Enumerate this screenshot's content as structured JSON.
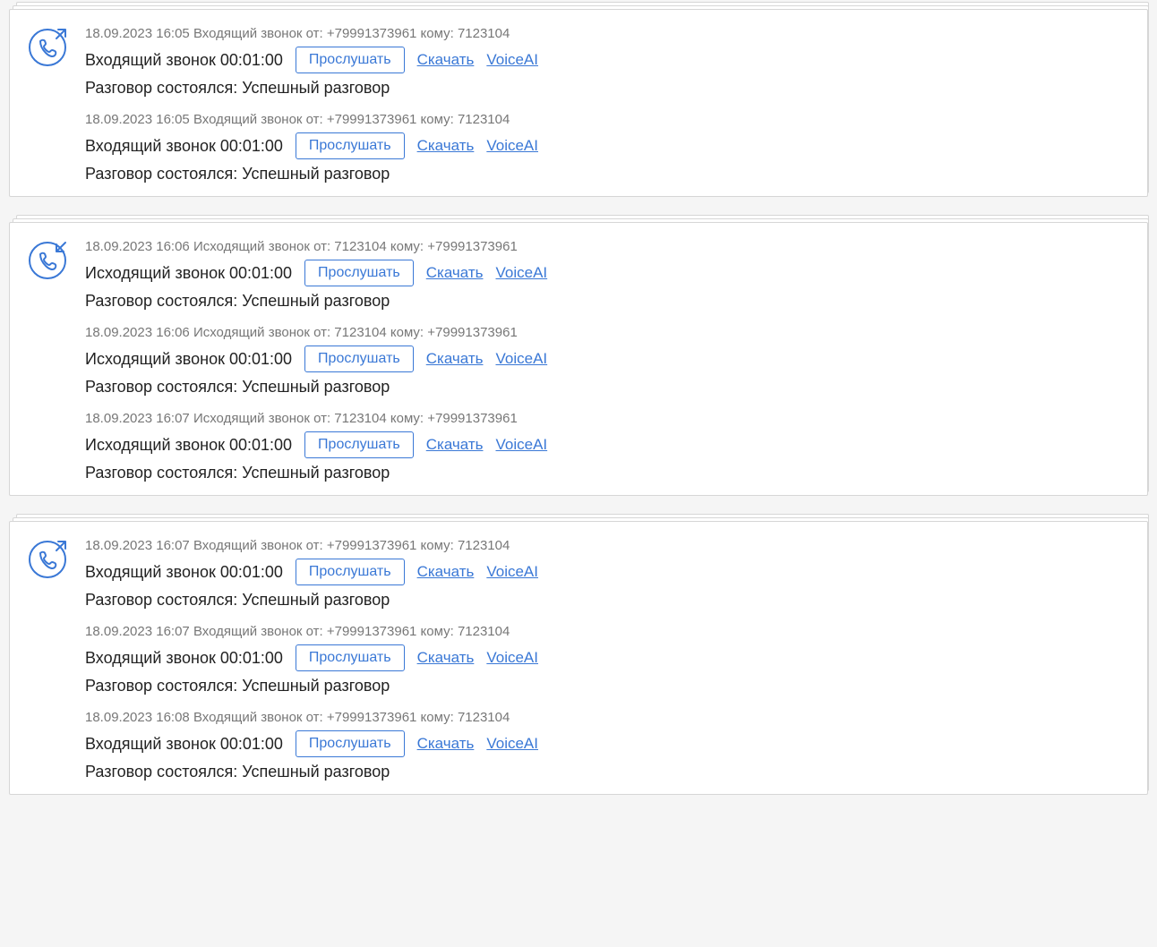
{
  "labels": {
    "play": "Прослушать",
    "download": "Скачать",
    "voiceai": "VoiceAI",
    "result_prefix": "Разговор состоялся: ",
    "from": "от:",
    "to": "кому:"
  },
  "groups": [
    {
      "direction": "incoming",
      "entries": [
        {
          "timestamp": "18.09.2023 16:05",
          "type_label": "Входящий звонок",
          "from": "+79991373961",
          "to": "7123104",
          "title": "Входящий звонок 00:01:00",
          "result": "Успешный разговор",
          "highlight_voiceai": true
        },
        {
          "timestamp": "18.09.2023 16:05",
          "type_label": "Входящий звонок",
          "from": "+79991373961",
          "to": "7123104",
          "title": "Входящий звонок 00:01:00",
          "result": "Успешный разговор",
          "highlight_voiceai": true
        }
      ]
    },
    {
      "direction": "outgoing",
      "entries": [
        {
          "timestamp": "18.09.2023 16:06",
          "type_label": "Исходящий звонок",
          "from": "7123104",
          "to": "+79991373961",
          "title": "Исходящий звонок 00:01:00",
          "result": "Успешный разговор",
          "highlight_voiceai": false
        },
        {
          "timestamp": "18.09.2023 16:06",
          "type_label": "Исходящий звонок",
          "from": "7123104",
          "to": "+79991373961",
          "title": "Исходящий звонок 00:01:00",
          "result": "Успешный разговор",
          "highlight_voiceai": false
        },
        {
          "timestamp": "18.09.2023 16:07",
          "type_label": "Исходящий звонок",
          "from": "7123104",
          "to": "+79991373961",
          "title": "Исходящий звонок 00:01:00",
          "result": "Успешный разговор",
          "highlight_voiceai": false
        }
      ]
    },
    {
      "direction": "incoming",
      "entries": [
        {
          "timestamp": "18.09.2023 16:07",
          "type_label": "Входящий звонок",
          "from": "+79991373961",
          "to": "7123104",
          "title": "Входящий звонок 00:01:00",
          "result": "Успешный разговор",
          "highlight_voiceai": false
        },
        {
          "timestamp": "18.09.2023 16:07",
          "type_label": "Входящий звонок",
          "from": "+79991373961",
          "to": "7123104",
          "title": "Входящий звонок 00:01:00",
          "result": "Успешный разговор",
          "highlight_voiceai": false
        },
        {
          "timestamp": "18.09.2023 16:08",
          "type_label": "Входящий звонок",
          "from": "+79991373961",
          "to": "7123104",
          "title": "Входящий звонок 00:01:00",
          "result": "Успешный разговор",
          "highlight_voiceai": false
        }
      ]
    }
  ]
}
